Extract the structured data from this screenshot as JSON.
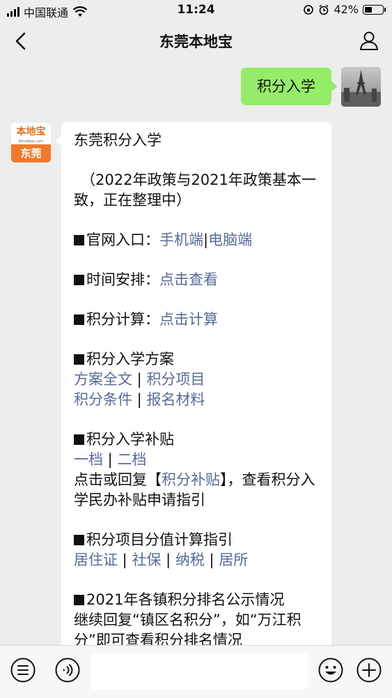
{
  "status_bar": {
    "carrier": "中国联通",
    "time": "11:24",
    "battery_percent": "42%",
    "battery_level": 0.42
  },
  "nav": {
    "title": "东莞本地宝"
  },
  "sent_message": {
    "text": "积分入学"
  },
  "bot_avatar": {
    "logo_text": "本地宝",
    "logo_url": "Bendibao.com",
    "city": "东莞"
  },
  "reply": {
    "title": "东莞积分入学",
    "note": "（2022年政策与2021年政策基本一致，正在整理中）",
    "website": {
      "label": "官网入口：",
      "link1": "手机端",
      "sep": "|",
      "link2": "电脑端"
    },
    "schedule": {
      "label": "时间安排：",
      "link": "点击查看"
    },
    "calc": {
      "label": "积分计算：",
      "link": "点击计算"
    },
    "plan": {
      "heading": "积分入学方案",
      "links": [
        "方案全文",
        "积分项目",
        "积分条件",
        "报名材料"
      ]
    },
    "subsidy": {
      "heading": "积分入学补贴",
      "links": [
        "一档",
        "二档"
      ],
      "text_before": "点击或回复【",
      "keyword": "积分补贴",
      "text_after": "】，查看积分入学民办补贴申请指引"
    },
    "guide": {
      "heading": "积分项目分值计算指引",
      "links": [
        "居住证",
        "社保",
        "纳税",
        "居所"
      ]
    },
    "ranking": {
      "heading": "2021年各镇积分排名公示情况",
      "text": "继续回复“镇区名积分”，如“万江积分”即可查看积分排名情况"
    },
    "separator": " | "
  },
  "icons": {
    "back": "chevron-left-icon",
    "user": "person-icon",
    "menu": "menu-list-icon",
    "voice": "voice-icon",
    "emoji": "smiley-icon",
    "add": "plus-circle-icon"
  },
  "colors": {
    "background": "#ededed",
    "sent_bubble": "#95ec69",
    "link": "#576b95",
    "brand_orange": "#ee7a2c"
  }
}
